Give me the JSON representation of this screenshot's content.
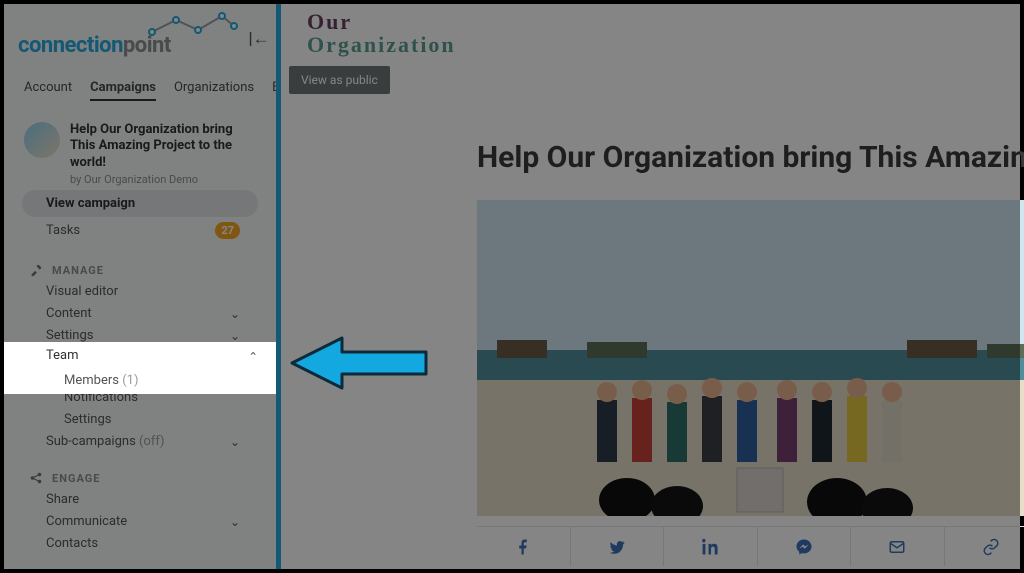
{
  "brand": {
    "part1": "connection",
    "part2": "point"
  },
  "collapse_glyph": "|←",
  "topnav": {
    "items": [
      "Account",
      "Campaigns",
      "Organizations",
      "Enterprise"
    ],
    "active_index": 1
  },
  "campaign": {
    "title": "Help Our Organization bring This Amazing Project to the world!",
    "subtitle": "by Our Organization Demo"
  },
  "nav": {
    "view_campaign": "View campaign",
    "tasks_label": "Tasks",
    "tasks_count": "27",
    "manage_header": "MANAGE",
    "visual_editor": "Visual editor",
    "content": "Content",
    "settings_top": "Settings",
    "team": "Team",
    "members_label": "Members",
    "members_count": "(1)",
    "notifications": "Notifications",
    "settings_team": "Settings",
    "sub_campaigns": "Sub-campaigns",
    "sub_campaigns_state": "(off)",
    "engage_header": "ENGAGE",
    "share": "Share",
    "communicate": "Communicate",
    "contacts": "Contacts"
  },
  "main": {
    "org_line1": "Our",
    "org_line2": "Organization",
    "view_public": "View as public",
    "headline": "Help Our Organization bring This Amazing Project to the world!"
  },
  "share_icons": [
    "facebook",
    "twitter",
    "linkedin",
    "messenger",
    "email",
    "link"
  ],
  "colors": {
    "accent": "#26a9e0",
    "badge": "#f5a623",
    "share": "#3b6fb6"
  }
}
